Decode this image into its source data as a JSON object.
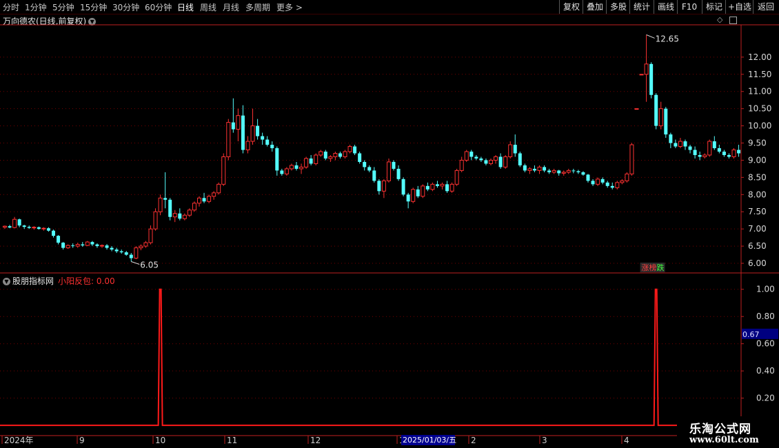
{
  "toolbar": {
    "periods": [
      "分时",
      "1分钟",
      "5分钟",
      "15分钟",
      "30分钟",
      "60分钟",
      "日线",
      "周线",
      "月线",
      "多周期",
      "更多 >"
    ],
    "active_period": "日线",
    "tools": [
      "复权",
      "叠加",
      "多股",
      "统计",
      "画线",
      "F10",
      "标记",
      "+自选",
      "返回"
    ]
  },
  "stock": {
    "title": "万向德农(日线,前复权)",
    "high_label": "12.65",
    "low_label": "6.05",
    "badge": "涨榜跌"
  },
  "indicator": {
    "title": "股朋指标网",
    "name": "小阳反包",
    "value": "0.00",
    "current_axis_value": "0.67"
  },
  "timeline": {
    "labels": [
      "2024年",
      "9",
      "10",
      "11",
      "12",
      "1",
      "2025/01/03/五",
      "2",
      "3",
      "4"
    ]
  },
  "watermark": {
    "line1": "乐淘公式网",
    "line2": "www.60lt.com"
  },
  "colors": {
    "up": "#ff3232",
    "down": "#54ffff",
    "grid": "#7a0000",
    "signal": "#ff1a1a",
    "axis": "#c02020"
  },
  "chart_data": [
    {
      "type": "candlestick",
      "title": "万向德农(日线,前复权)",
      "y_ticks": [
        6.0,
        6.5,
        7.0,
        7.5,
        8.0,
        8.5,
        9.0,
        9.5,
        10.0,
        10.5,
        11.0,
        11.5,
        12.0
      ],
      "ylim": [
        5.8,
        12.9
      ],
      "annotations": [
        {
          "label": "12.65",
          "value": 12.65
        },
        {
          "label": "6.05",
          "value": 6.05
        }
      ],
      "ohlc": [
        [
          7.05,
          7.1,
          7.0,
          7.08
        ],
        [
          7.08,
          7.12,
          7.02,
          7.04
        ],
        [
          7.04,
          7.35,
          7.02,
          7.28
        ],
        [
          7.28,
          7.3,
          7.05,
          7.1
        ],
        [
          7.1,
          7.12,
          7.0,
          7.06
        ],
        [
          7.06,
          7.1,
          7.0,
          7.03
        ],
        [
          7.03,
          7.08,
          6.98,
          7.05
        ],
        [
          7.05,
          7.07,
          6.98,
          7.0
        ],
        [
          7.0,
          7.05,
          6.95,
          7.02
        ],
        [
          7.02,
          7.05,
          6.92,
          6.95
        ],
        [
          6.95,
          6.98,
          6.75,
          6.8
        ],
        [
          6.8,
          6.82,
          6.55,
          6.6
        ],
        [
          6.6,
          6.62,
          6.4,
          6.45
        ],
        [
          6.45,
          6.55,
          6.42,
          6.52
        ],
        [
          6.52,
          6.58,
          6.45,
          6.5
        ],
        [
          6.5,
          6.6,
          6.45,
          6.55
        ],
        [
          6.55,
          6.62,
          6.48,
          6.52
        ],
        [
          6.52,
          6.65,
          6.5,
          6.62
        ],
        [
          6.62,
          6.65,
          6.5,
          6.55
        ],
        [
          6.55,
          6.58,
          6.45,
          6.5
        ],
        [
          6.5,
          6.55,
          6.45,
          6.52
        ],
        [
          6.52,
          6.56,
          6.4,
          6.45
        ],
        [
          6.45,
          6.5,
          6.35,
          6.4
        ],
        [
          6.4,
          6.45,
          6.3,
          6.35
        ],
        [
          6.35,
          6.4,
          6.28,
          6.32
        ],
        [
          6.32,
          6.36,
          6.22,
          6.25
        ],
        [
          6.25,
          6.3,
          6.05,
          6.15
        ],
        [
          6.15,
          6.5,
          6.12,
          6.45
        ],
        [
          6.45,
          6.55,
          6.38,
          6.5
        ],
        [
          6.5,
          6.65,
          6.45,
          6.6
        ],
        [
          6.6,
          7.1,
          6.55,
          7.0
        ],
        [
          7.0,
          7.6,
          6.95,
          7.5
        ],
        [
          7.5,
          8.0,
          7.4,
          7.9
        ],
        [
          7.9,
          8.65,
          7.6,
          7.85
        ],
        [
          7.85,
          7.9,
          7.25,
          7.35
        ],
        [
          7.35,
          7.55,
          7.2,
          7.45
        ],
        [
          7.45,
          7.6,
          7.25,
          7.3
        ],
        [
          7.3,
          7.45,
          7.25,
          7.4
        ],
        [
          7.4,
          7.6,
          7.35,
          7.55
        ],
        [
          7.55,
          7.8,
          7.5,
          7.75
        ],
        [
          7.75,
          7.95,
          7.65,
          7.9
        ],
        [
          7.9,
          8.05,
          7.75,
          7.8
        ],
        [
          7.8,
          8.0,
          7.75,
          7.95
        ],
        [
          7.95,
          8.1,
          7.85,
          8.05
        ],
        [
          8.05,
          8.35,
          8.0,
          8.3
        ],
        [
          8.3,
          9.2,
          8.25,
          9.1
        ],
        [
          9.1,
          10.2,
          9.0,
          10.1
        ],
        [
          10.1,
          10.8,
          9.8,
          9.9
        ],
        [
          9.9,
          10.5,
          9.55,
          10.3
        ],
        [
          10.3,
          10.6,
          9.2,
          9.3
        ],
        [
          9.3,
          9.7,
          9.2,
          9.55
        ],
        [
          9.55,
          10.5,
          9.45,
          10.0
        ],
        [
          10.0,
          10.2,
          9.6,
          9.7
        ],
        [
          9.7,
          9.8,
          9.45,
          9.6
        ],
        [
          9.6,
          9.7,
          9.4,
          9.45
        ],
        [
          9.45,
          9.55,
          9.25,
          9.35
        ],
        [
          9.35,
          9.4,
          8.55,
          8.7
        ],
        [
          8.7,
          8.75,
          8.55,
          8.6
        ],
        [
          8.6,
          8.8,
          8.55,
          8.75
        ],
        [
          8.75,
          8.9,
          8.7,
          8.85
        ],
        [
          8.85,
          8.95,
          8.7,
          8.75
        ],
        [
          8.75,
          8.9,
          8.6,
          8.8
        ],
        [
          8.8,
          9.1,
          8.75,
          9.05
        ],
        [
          9.05,
          9.15,
          8.85,
          8.9
        ],
        [
          8.9,
          9.2,
          8.85,
          9.15
        ],
        [
          9.15,
          9.3,
          9.1,
          9.25
        ],
        [
          9.25,
          9.3,
          9.0,
          9.05
        ],
        [
          9.05,
          9.15,
          8.95,
          9.1
        ],
        [
          9.1,
          9.25,
          9.0,
          9.2
        ],
        [
          9.2,
          9.25,
          9.05,
          9.1
        ],
        [
          9.1,
          9.3,
          9.05,
          9.25
        ],
        [
          9.25,
          9.45,
          9.2,
          9.4
        ],
        [
          9.4,
          9.45,
          9.15,
          9.2
        ],
        [
          9.2,
          9.25,
          8.9,
          8.95
        ],
        [
          8.95,
          9.0,
          8.7,
          8.8
        ],
        [
          8.8,
          8.85,
          8.65,
          8.7
        ],
        [
          8.7,
          8.8,
          8.35,
          8.4
        ],
        [
          8.4,
          8.45,
          8.0,
          8.1
        ],
        [
          8.1,
          8.45,
          7.9,
          8.4
        ],
        [
          8.4,
          9.05,
          8.35,
          8.95
        ],
        [
          8.95,
          9.0,
          8.7,
          8.75
        ],
        [
          8.75,
          8.85,
          8.4,
          8.45
        ],
        [
          8.45,
          8.5,
          7.95,
          8.0
        ],
        [
          8.0,
          8.05,
          7.6,
          7.8
        ],
        [
          7.8,
          8.2,
          7.75,
          8.15
        ],
        [
          8.15,
          8.25,
          7.9,
          7.95
        ],
        [
          7.95,
          8.3,
          7.9,
          8.25
        ],
        [
          8.25,
          8.35,
          8.1,
          8.15
        ],
        [
          8.15,
          8.35,
          8.1,
          8.3
        ],
        [
          8.3,
          8.4,
          8.2,
          8.25
        ],
        [
          8.25,
          8.35,
          8.15,
          8.3
        ],
        [
          8.3,
          8.4,
          8.05,
          8.1
        ],
        [
          8.1,
          8.35,
          8.05,
          8.3
        ],
        [
          8.3,
          8.75,
          8.25,
          8.7
        ],
        [
          8.7,
          9.1,
          8.65,
          9.0
        ],
        [
          9.0,
          9.3,
          8.95,
          9.25
        ],
        [
          9.25,
          9.3,
          9.0,
          9.1
        ],
        [
          9.1,
          9.15,
          9.0,
          9.05
        ],
        [
          9.05,
          9.1,
          8.95,
          9.0
        ],
        [
          9.0,
          9.05,
          8.85,
          8.9
        ],
        [
          8.9,
          9.05,
          8.85,
          9.0
        ],
        [
          9.0,
          9.15,
          8.9,
          9.1
        ],
        [
          9.1,
          9.2,
          8.75,
          8.8
        ],
        [
          8.8,
          9.15,
          8.75,
          9.1
        ],
        [
          9.1,
          9.55,
          9.05,
          9.45
        ],
        [
          9.45,
          9.75,
          9.1,
          9.2
        ],
        [
          9.2,
          9.25,
          8.8,
          8.85
        ],
        [
          8.85,
          8.9,
          8.65,
          8.7
        ],
        [
          8.7,
          8.8,
          8.6,
          8.75
        ],
        [
          8.75,
          8.85,
          8.65,
          8.7
        ],
        [
          8.7,
          8.85,
          8.6,
          8.8
        ],
        [
          8.8,
          8.85,
          8.65,
          8.7
        ],
        [
          8.7,
          8.75,
          8.6,
          8.65
        ],
        [
          8.65,
          8.75,
          8.6,
          8.7
        ],
        [
          8.7,
          8.72,
          8.55,
          8.62
        ],
        [
          8.62,
          8.7,
          8.55,
          8.65
        ],
        [
          8.65,
          8.75,
          8.6,
          8.7
        ],
        [
          8.7,
          8.75,
          8.62,
          8.68
        ],
        [
          8.68,
          8.72,
          8.6,
          8.65
        ],
        [
          8.65,
          8.68,
          8.55,
          8.58
        ],
        [
          8.58,
          8.6,
          8.35,
          8.4
        ],
        [
          8.4,
          8.45,
          8.25,
          8.3
        ],
        [
          8.3,
          8.5,
          8.25,
          8.45
        ],
        [
          8.45,
          8.5,
          8.3,
          8.35
        ],
        [
          8.35,
          8.4,
          8.2,
          8.25
        ],
        [
          8.25,
          8.35,
          8.15,
          8.2
        ],
        [
          8.2,
          8.4,
          8.15,
          8.35
        ],
        [
          8.35,
          8.45,
          8.3,
          8.4
        ],
        [
          8.4,
          8.65,
          8.35,
          8.6
        ],
        [
          8.6,
          9.5,
          8.55,
          9.45
        ],
        [
          10.5,
          10.5,
          10.5,
          10.5
        ],
        [
          11.5,
          11.5,
          11.5,
          11.5
        ],
        [
          11.5,
          12.65,
          10.7,
          11.8
        ],
        [
          11.8,
          11.85,
          10.8,
          10.9
        ],
        [
          10.9,
          10.95,
          9.9,
          10.0
        ],
        [
          10.0,
          10.7,
          9.9,
          10.5
        ],
        [
          10.5,
          10.55,
          9.65,
          9.75
        ],
        [
          9.75,
          9.8,
          9.35,
          9.5
        ],
        [
          9.5,
          9.6,
          9.35,
          9.4
        ],
        [
          9.4,
          9.65,
          9.35,
          9.55
        ],
        [
          9.55,
          9.6,
          9.3,
          9.4
        ],
        [
          9.4,
          9.45,
          9.2,
          9.3
        ],
        [
          9.3,
          9.4,
          9.05,
          9.15
        ],
        [
          9.15,
          9.25,
          9.0,
          9.1
        ],
        [
          9.1,
          9.2,
          9.05,
          9.15
        ],
        [
          9.15,
          9.6,
          9.1,
          9.55
        ],
        [
          9.55,
          9.7,
          9.3,
          9.35
        ],
        [
          9.35,
          9.45,
          9.2,
          9.25
        ],
        [
          9.25,
          9.3,
          9.1,
          9.15
        ],
        [
          9.15,
          9.2,
          9.05,
          9.1
        ],
        [
          9.1,
          9.35,
          9.05,
          9.3
        ],
        [
          9.3,
          9.45,
          9.1,
          9.2
        ]
      ]
    },
    {
      "type": "line",
      "title": "小阳反包",
      "y_ticks": [
        0.2,
        0.4,
        0.6,
        0.8,
        1.0
      ],
      "ylim": [
        -0.05,
        1.1
      ],
      "signals": [
        {
          "bar": 32,
          "value": 1.0
        },
        {
          "bar": 134,
          "value": 1.0
        }
      ]
    }
  ]
}
